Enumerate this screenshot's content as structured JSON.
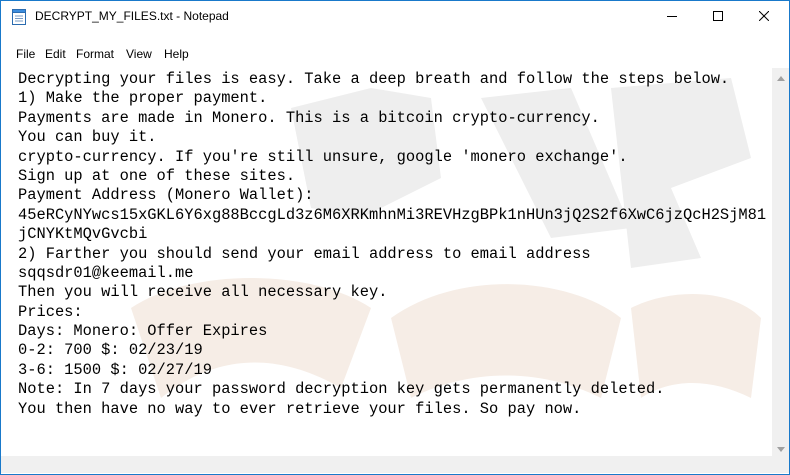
{
  "window": {
    "title": "DECRYPT_MY_FILES.txt - Notepad"
  },
  "icons": {
    "app": "notepad-icon",
    "minimize": "minimize-icon",
    "maximize": "maximize-icon",
    "close": "close-icon"
  },
  "menu": [
    "File",
    "Edit",
    "Format",
    "View",
    "Help"
  ],
  "content": {
    "lines": [
      "Decrypting your files is easy. Take a deep breath and follow the steps below.",
      "1) Make the proper payment.",
      "Payments are made in Monero. This is a bitcoin crypto-currency.",
      "You can buy it.",
      "crypto-currency. If you're still unsure, google 'monero exchange'.",
      "Sign up at one of these sites.",
      "Payment Address (Monero Wallet):",
      "45eRCyNYwcs15xGKL6Y6xg88BccgLd3z6M6XRKmhnMi3REVHzgBPk1nHUn3jQ2S2f6XwC6jzQcH2SjM81",
      "jCNYKtMQvGvcbi",
      "2) Farther you should send your email address to email address",
      "sqqsdr01@keemail.me",
      "Then you will receive all necessary key.",
      "Prices:",
      "Days: Monero: Offer Expires",
      "0-2: 700 $: 02/23/19",
      "3-6: 1500 $: 02/27/19",
      "Note: In 7 days your password decryption key gets permanently deleted.",
      "You then have no way to ever retrieve your files. So pay now."
    ]
  },
  "colors": {
    "window_border": "#1979ca",
    "scrollbar": "#f0f0f0",
    "watermark": "#e8e8e8"
  }
}
